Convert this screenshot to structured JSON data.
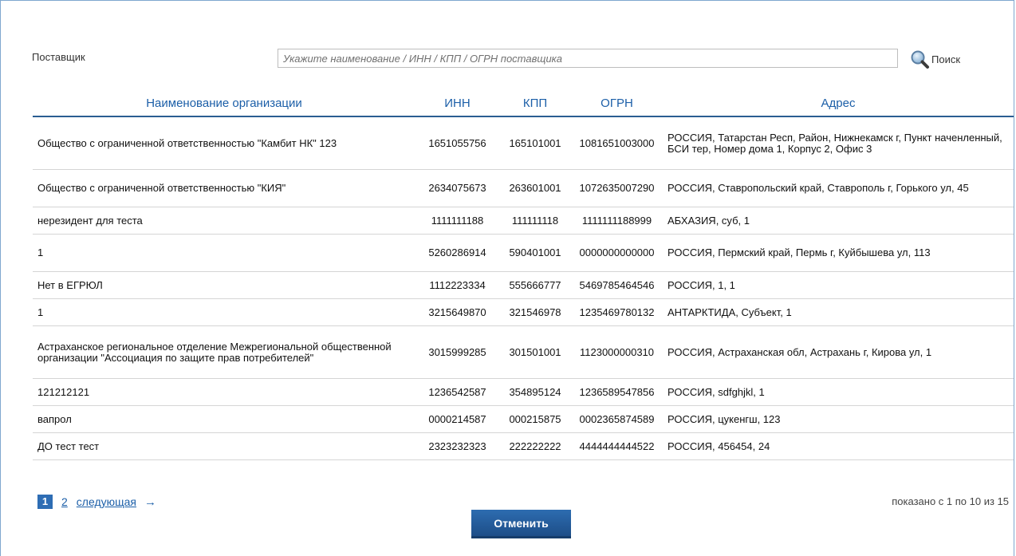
{
  "filter": {
    "supplier_label": "Поставщик",
    "search_placeholder": "Укажите наименование / ИНН / КПП / ОГРН поставщика",
    "search_value": "",
    "search_button": "Поиск"
  },
  "table": {
    "columns": [
      "Наименование организации",
      "ИНН",
      "КПП",
      "ОГРН",
      "Адрес"
    ],
    "rows": [
      {
        "name": "Общество с ограниченной ответственностью \"Камбит НК\" 123",
        "inn": "1651055756",
        "kpp": "165101001",
        "ogrn": "1081651003000",
        "address": "РОССИЯ, Татарстан Респ, Район, Нижнекамск г, Пункт наченленный, БСИ тер, Номер дома 1, Корпус 2, Офис 3"
      },
      {
        "name": "Общество с ограниченной ответственностью \"КИЯ\"",
        "inn": "2634075673",
        "kpp": "263601001",
        "ogrn": "1072635007290",
        "address": "РОССИЯ, Ставропольский край, Ставрополь г, Горького ул, 45"
      },
      {
        "name": "нерезидент для теста",
        "inn": "1111111188",
        "kpp": "111111118",
        "ogrn": "1111111188999",
        "address": "АБХАЗИЯ, суб, 1"
      },
      {
        "name": "1",
        "inn": "5260286914",
        "kpp": "590401001",
        "ogrn": "0000000000000",
        "address": "РОССИЯ, Пермский край, Пермь г, Куйбышева ул, 113"
      },
      {
        "name": "Нет в ЕГРЮЛ",
        "inn": "1112223334",
        "kpp": "555666777",
        "ogrn": "5469785464546",
        "address": "РОССИЯ, 1, 1"
      },
      {
        "name": "1",
        "inn": "3215649870",
        "kpp": "321546978",
        "ogrn": "1235469780132",
        "address": "АНТАРКТИДА, Субъект, 1"
      },
      {
        "name": "Астраханское региональное отделение Межрегиональной общественной организации \"Ассоциация по защите прав потребителей\"",
        "inn": "3015999285",
        "kpp": "301501001",
        "ogrn": "1123000000310",
        "address": "РОССИЯ, Астраханская обл, Астрахань г, Кирова ул, 1"
      },
      {
        "name": "121212121",
        "inn": "1236542587",
        "kpp": "354895124",
        "ogrn": "1236589547856",
        "address": "РОССИЯ, sdfghjkl, 1"
      },
      {
        "name": "вапрол",
        "inn": "0000214587",
        "kpp": "000215875",
        "ogrn": "0002365874589",
        "address": "РОССИЯ, цукенгш, 123"
      },
      {
        "name": "ДО тест тест",
        "inn": "2323232323",
        "kpp": "222222222",
        "ogrn": "4444444444522",
        "address": "РОССИЯ, 456454, 24"
      }
    ]
  },
  "pagination": {
    "current_page": "1",
    "page_2": "2",
    "next_label": "следующая",
    "next_arrow": "→",
    "shown_info": "показано с 1 по 10 из 15"
  },
  "actions": {
    "cancel_label": "Отменить"
  },
  "colors": {
    "accent": "#2e6db4",
    "header_text": "#1c5fa8"
  }
}
